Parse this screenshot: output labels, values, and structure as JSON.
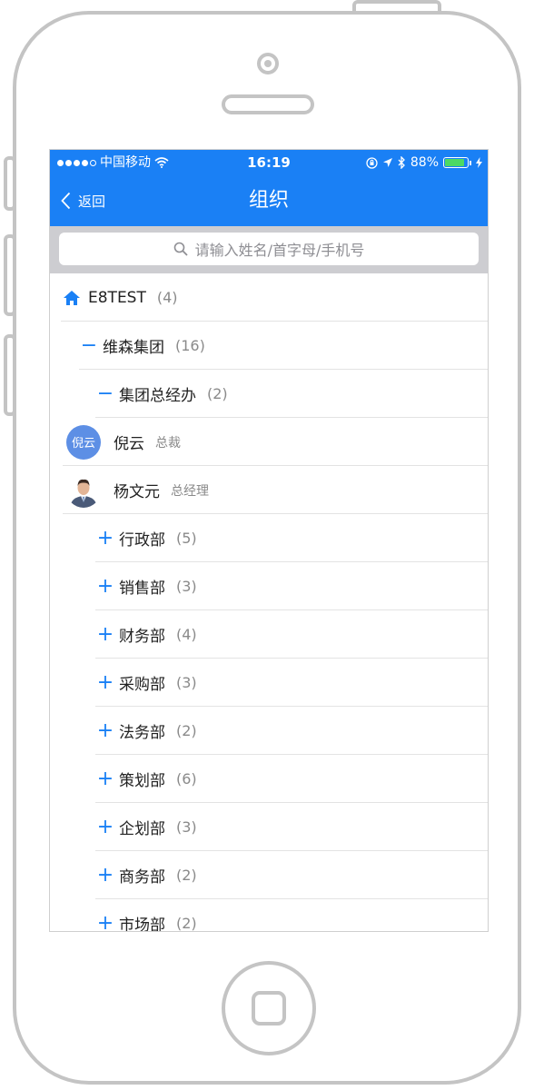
{
  "status_bar": {
    "carrier": "中国移动",
    "time": "16:19",
    "battery": "88%",
    "battery_level": 0.88
  },
  "nav": {
    "back_label": "返回",
    "title": "组织"
  },
  "search": {
    "placeholder": "请输入姓名/首字母/手机号"
  },
  "tree": {
    "root": {
      "label": "E8TEST",
      "count": "(4)"
    },
    "group": {
      "label": "维森集团",
      "count": "(16)"
    },
    "office": {
      "label": "集团总经办",
      "count": "(2)"
    },
    "people": [
      {
        "avatar_text": "倪云",
        "name": "倪云",
        "title": "总裁"
      },
      {
        "avatar_text": "",
        "name": "杨文元",
        "title": "总经理"
      }
    ],
    "departments": [
      {
        "label": "行政部",
        "count": "(5)"
      },
      {
        "label": "销售部",
        "count": "(3)"
      },
      {
        "label": "财务部",
        "count": "(4)"
      },
      {
        "label": "采购部",
        "count": "(3)"
      },
      {
        "label": "法务部",
        "count": "(2)"
      },
      {
        "label": "策划部",
        "count": "(6)"
      },
      {
        "label": "企划部",
        "count": "(3)"
      },
      {
        "label": "商务部",
        "count": "(2)"
      },
      {
        "label": "市场部",
        "count": "(2)"
      }
    ]
  },
  "colors": {
    "accent": "#1a80f5",
    "avatar_bg": "#5d8fe5",
    "battery": "#4cd964"
  },
  "icons": {
    "back": "chevron-left-icon",
    "search": "search-icon",
    "root": "home-icon",
    "expanded": "minus-icon",
    "collapsed": "plus-icon"
  }
}
